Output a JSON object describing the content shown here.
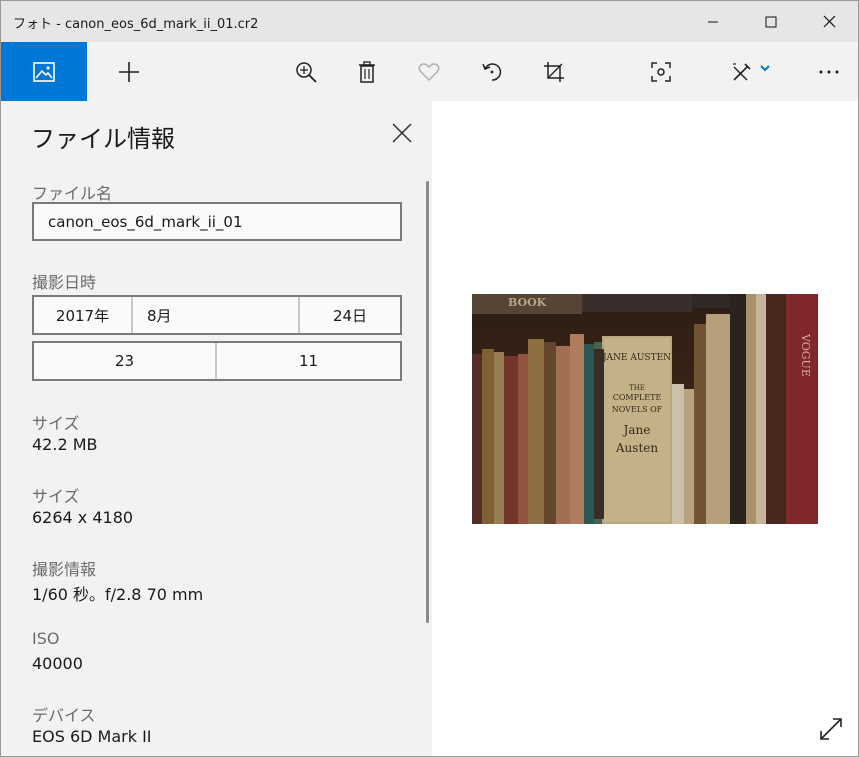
{
  "window": {
    "title": "フォト - canon_eos_6d_mark_ii_01.cr2"
  },
  "toolbar": {
    "items": [
      "photo-app-icon",
      "add-icon",
      "zoom-in-icon",
      "delete-icon",
      "favorite-icon",
      "rotate-icon",
      "crop-icon",
      "enhance-icon",
      "edit-icon",
      "more-icon"
    ]
  },
  "panel": {
    "title": "ファイル情報",
    "filename_label": "ファイル名",
    "filename_value": "canon_eos_6d_mark_ii_01",
    "date_label": "撮影日時",
    "date_year": "2017年",
    "date_month": "8月",
    "date_day": "24日",
    "time_hour": "23",
    "time_minute": "11",
    "size_label": "サイズ",
    "size_value": "42.2 MB",
    "dimensions_label": "サイズ",
    "dimensions_value": "6264 x 4180",
    "shooting_label": "撮影情報",
    "shooting_value": "1/60 秒。f/2.8 70 mm",
    "iso_label": "ISO",
    "iso_value": "40000",
    "device_label": "デバイス",
    "device_value": "EOS 6D Mark II"
  },
  "photo": {
    "book_top_label": "BOOK",
    "spine_author": "JANE AUSTEN",
    "spine_title_1": "THE",
    "spine_title_2": "COMPLETE",
    "spine_title_3": "NOVELS OF",
    "spine_title_4": "Jane",
    "spine_title_5": "Austen",
    "red_spine_text": "VOGUE"
  }
}
